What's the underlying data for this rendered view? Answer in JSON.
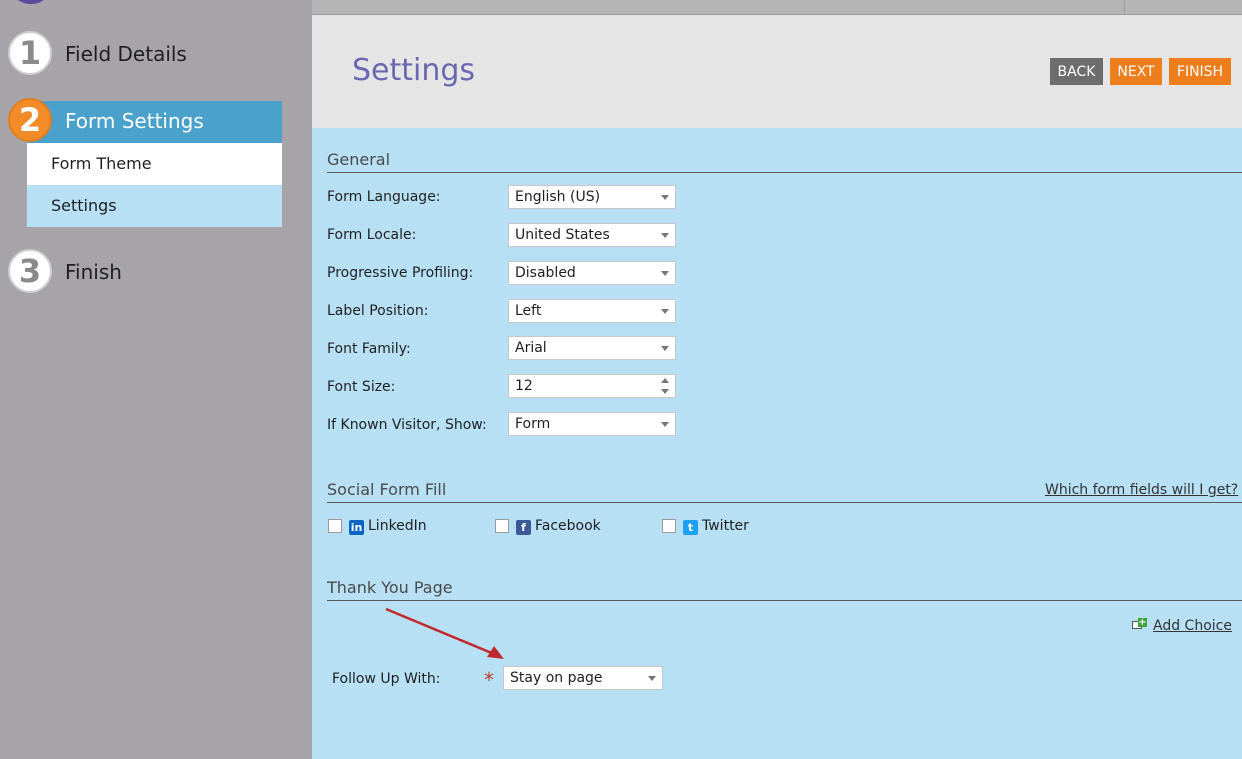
{
  "sidebar": {
    "steps": [
      {
        "number": "1",
        "label": "Field Details"
      },
      {
        "number": "2",
        "label": "Form Settings"
      },
      {
        "number": "3",
        "label": "Finish"
      }
    ],
    "sub_items": [
      {
        "label": "Form Theme"
      },
      {
        "label": "Settings"
      }
    ]
  },
  "header": {
    "title": "Settings",
    "back_label": "BACK",
    "next_label": "NEXT",
    "finish_label": "FINISH"
  },
  "general": {
    "title": "General",
    "fields": [
      {
        "label": "Form Language:",
        "value": "English (US)"
      },
      {
        "label": "Form Locale:",
        "value": "United States"
      },
      {
        "label": "Progressive Profiling:",
        "value": "Disabled"
      },
      {
        "label": "Label Position:",
        "value": "Left"
      },
      {
        "label": "Font Family:",
        "value": "Arial"
      },
      {
        "label": "Font Size:",
        "value": "12"
      },
      {
        "label": "If Known Visitor, Show:",
        "value": "Form"
      }
    ]
  },
  "social": {
    "title": "Social Form Fill",
    "help_link": "Which form fields will I get?",
    "options": [
      {
        "label": "LinkedIn",
        "checked": false,
        "icon": "linkedin-icon",
        "color": "#0a66c2"
      },
      {
        "label": "Facebook",
        "checked": false,
        "icon": "facebook-icon",
        "color": "#3b5998"
      },
      {
        "label": "Twitter",
        "checked": false,
        "icon": "twitter-icon",
        "color": "#1da1f2"
      }
    ]
  },
  "thank_you": {
    "title": "Thank You Page",
    "add_choice": "Add Choice",
    "follow_up_label": "Follow Up With:",
    "follow_up_value": "Stay on page"
  },
  "colors": {
    "accent_orange": "#ee7d1c",
    "accent_blue": "#4aa2cc",
    "content_bg": "#b7e0f5"
  }
}
